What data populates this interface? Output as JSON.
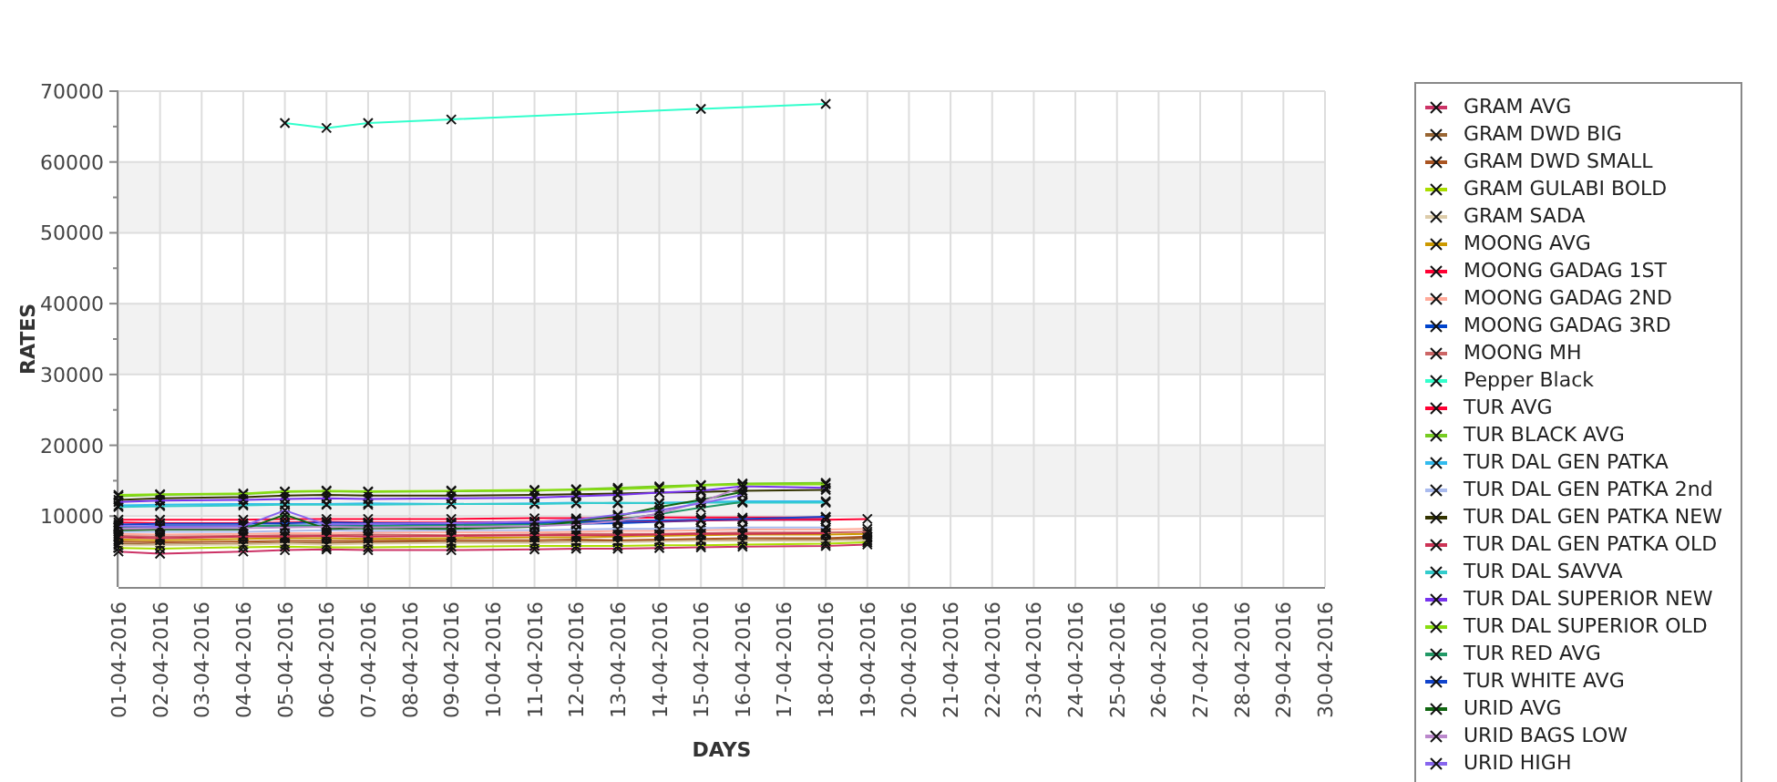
{
  "chart": {
    "chart_data": {
      "type": "line",
      "xlabel": "DAYS",
      "ylabel": "RATES",
      "ylim": [
        0,
        70000
      ],
      "grid": true,
      "yticks": [
        10000,
        20000,
        30000,
        40000,
        50000,
        60000,
        70000
      ],
      "categories": [
        "01-04-2016",
        "02-04-2016",
        "03-04-2016",
        "04-04-2016",
        "05-04-2016",
        "06-04-2016",
        "07-04-2016",
        "08-04-2016",
        "09-04-2016",
        "10-04-2016",
        "11-04-2016",
        "12-04-2016",
        "13-04-2016",
        "14-04-2016",
        "15-04-2016",
        "16-04-2016",
        "17-04-2016",
        "18-04-2016",
        "19-04-2016",
        "20-04-2016",
        "21-04-2016",
        "22-04-2016",
        "23-04-2016",
        "24-04-2016",
        "25-04-2016",
        "26-04-2016",
        "27-04-2016",
        "28-04-2016",
        "29-04-2016",
        "30-04-2016"
      ],
      "series": [
        {
          "name": "GRAM AVG",
          "color": "#cc3366",
          "marker": "x",
          "values": [
            5000,
            4700,
            null,
            5000,
            5200,
            5300,
            5200,
            null,
            5200,
            null,
            5300,
            5400,
            5400,
            5500,
            5600,
            5700,
            null,
            5800,
            6000,
            null,
            null,
            null,
            null,
            null,
            null,
            null,
            null,
            null,
            null,
            null
          ]
        },
        {
          "name": "GRAM DWD BIG",
          "color": "#996633",
          "marker": "x",
          "values": [
            6100,
            6000,
            null,
            6100,
            6200,
            6200,
            6300,
            null,
            6300,
            null,
            6300,
            6400,
            6500,
            6500,
            6600,
            6600,
            null,
            6700,
            6900,
            null,
            null,
            null,
            null,
            null,
            null,
            null,
            null,
            null,
            null,
            null
          ]
        },
        {
          "name": "GRAM DWD SMALL",
          "color": "#aa5522",
          "marker": "x",
          "values": [
            6400,
            6300,
            null,
            6400,
            6500,
            6500,
            6500,
            null,
            6600,
            null,
            6600,
            6700,
            6600,
            6700,
            6800,
            6900,
            null,
            6900,
            7100,
            null,
            null,
            null,
            null,
            null,
            null,
            null,
            null,
            null,
            null,
            null
          ]
        },
        {
          "name": "GRAM GULABI BOLD",
          "color": "#aadd00",
          "marker": "x",
          "values": [
            5500,
            5400,
            null,
            5600,
            5700,
            5600,
            5600,
            null,
            5700,
            null,
            5800,
            5800,
            5800,
            5900,
            5900,
            6000,
            null,
            6100,
            6300,
            null,
            null,
            null,
            null,
            null,
            null,
            null,
            null,
            null,
            null,
            null
          ]
        },
        {
          "name": "GRAM SADA",
          "color": "#ddccaa",
          "marker": "x",
          "values": [
            5900,
            5900,
            null,
            6000,
            6100,
            6000,
            6100,
            null,
            6200,
            null,
            6200,
            6300,
            6300,
            6400,
            6500,
            6500,
            null,
            6500,
            6600,
            null,
            null,
            null,
            null,
            null,
            null,
            null,
            null,
            null,
            null,
            null
          ]
        },
        {
          "name": "MOONG AVG",
          "color": "#cc9900",
          "marker": "x",
          "values": [
            6700,
            6600,
            null,
            6800,
            6900,
            6900,
            6800,
            null,
            6900,
            null,
            7000,
            7000,
            7100,
            7200,
            7300,
            7400,
            null,
            7400,
            7500,
            null,
            null,
            null,
            null,
            null,
            null,
            null,
            null,
            null,
            null,
            null
          ]
        },
        {
          "name": "MOONG GADAG 1ST",
          "color": "#ff0033",
          "marker": "x",
          "values": [
            9500,
            9500,
            null,
            9500,
            9600,
            9600,
            9600,
            null,
            9600,
            null,
            9700,
            9700,
            9700,
            9800,
            9800,
            9800,
            null,
            9800,
            null,
            null,
            null,
            null,
            null,
            null,
            null,
            null,
            null,
            null,
            null,
            null
          ]
        },
        {
          "name": "MOONG GADAG 2ND",
          "color": "#ffaa99",
          "marker": "x",
          "values": [
            7500,
            7400,
            null,
            7500,
            7600,
            7600,
            7700,
            null,
            7700,
            null,
            7700,
            7800,
            7900,
            7900,
            8000,
            8100,
            null,
            8100,
            8200,
            null,
            null,
            null,
            null,
            null,
            null,
            null,
            null,
            null,
            null,
            null
          ]
        },
        {
          "name": "MOONG GADAG 3RD",
          "color": "#0044cc",
          "marker": "x",
          "values": [
            8500,
            8600,
            null,
            8600,
            8700,
            8700,
            8700,
            null,
            8800,
            null,
            8900,
            8900,
            9000,
            9200,
            9400,
            9500,
            null,
            9500,
            null,
            null,
            null,
            null,
            null,
            null,
            null,
            null,
            null,
            null,
            null,
            null
          ]
        },
        {
          "name": "MOONG MH",
          "color": "#cc6666",
          "marker": "x",
          "values": [
            7200,
            7100,
            null,
            7200,
            7300,
            7300,
            7400,
            null,
            7300,
            null,
            7400,
            7500,
            7500,
            7500,
            7600,
            7700,
            null,
            7700,
            7800,
            null,
            null,
            null,
            null,
            null,
            null,
            null,
            null,
            null,
            null,
            null
          ]
        },
        {
          "name": "Pepper Black",
          "color": "#33ffcc",
          "marker": "x",
          "values": [
            null,
            null,
            null,
            null,
            65500,
            64800,
            65500,
            null,
            66000,
            null,
            null,
            null,
            null,
            null,
            67500,
            null,
            null,
            68200,
            null,
            null,
            null,
            null,
            null,
            null,
            null,
            null,
            null,
            null,
            null,
            null
          ]
        },
        {
          "name": "TUR AVG",
          "color": "#ff0033",
          "marker": "x",
          "values": [
            9100,
            9000,
            null,
            9000,
            9100,
            9200,
            9100,
            null,
            9100,
            null,
            9200,
            9300,
            9300,
            9300,
            9400,
            9500,
            null,
            9500,
            9600,
            null,
            null,
            null,
            null,
            null,
            null,
            null,
            null,
            null,
            null,
            null
          ]
        },
        {
          "name": "TUR BLACK AVG",
          "color": "#77cc22",
          "marker": "x",
          "values": [
            12800,
            13000,
            null,
            13100,
            13400,
            13500,
            13400,
            null,
            13500,
            null,
            13600,
            13800,
            14000,
            14200,
            14400,
            14600,
            null,
            14700,
            null,
            null,
            null,
            null,
            null,
            null,
            null,
            null,
            null,
            null,
            null,
            null
          ]
        },
        {
          "name": "TUR DAL GEN PATKA",
          "color": "#33bbee",
          "marker": "x",
          "values": [
            11500,
            11600,
            null,
            11700,
            11700,
            11700,
            11800,
            null,
            11700,
            null,
            11800,
            11900,
            11800,
            11900,
            12000,
            12100,
            null,
            12100,
            null,
            null,
            null,
            null,
            null,
            null,
            null,
            null,
            null,
            null,
            null,
            null
          ]
        },
        {
          "name": "TUR DAL GEN PATKA 2nd",
          "color": "#aabbee",
          "marker": "x",
          "values": [
            7800,
            7800,
            null,
            7800,
            7900,
            8000,
            7900,
            null,
            8000,
            null,
            8000,
            8100,
            8200,
            8200,
            8300,
            8400,
            null,
            8400,
            null,
            null,
            null,
            null,
            null,
            null,
            null,
            null,
            null,
            null,
            null,
            null
          ]
        },
        {
          "name": "TUR DAL GEN PATKA NEW",
          "color": "#333300",
          "marker": "x",
          "values": [
            12300,
            12500,
            null,
            12700,
            12900,
            13000,
            12900,
            null,
            12900,
            null,
            13000,
            13100,
            13200,
            13300,
            13400,
            13600,
            null,
            13700,
            null,
            null,
            null,
            null,
            null,
            null,
            null,
            null,
            null,
            null,
            null,
            null
          ]
        },
        {
          "name": "TUR DAL GEN PATKA OLD",
          "color": "#cc3355",
          "marker": "x",
          "values": [
            7000,
            6900,
            null,
            7100,
            7100,
            7200,
            7100,
            null,
            7200,
            null,
            7300,
            7300,
            7300,
            7400,
            7500,
            7500,
            null,
            7600,
            null,
            null,
            null,
            null,
            null,
            null,
            null,
            null,
            null,
            null,
            null,
            null
          ]
        },
        {
          "name": "TUR DAL SAVVA",
          "color": "#33cccc",
          "marker": "x",
          "values": [
            11300,
            11400,
            null,
            11500,
            11600,
            11600,
            11600,
            null,
            11700,
            null,
            11700,
            11800,
            11900,
            11800,
            11900,
            11900,
            null,
            11900,
            null,
            null,
            null,
            null,
            null,
            null,
            null,
            null,
            null,
            null,
            null,
            null
          ]
        },
        {
          "name": "TUR DAL SUPERIOR NEW",
          "color": "#7733ee",
          "marker": "x",
          "values": [
            12000,
            12200,
            null,
            12300,
            12400,
            12500,
            12400,
            null,
            12500,
            null,
            12600,
            12800,
            13000,
            13300,
            13600,
            14200,
            null,
            14000,
            null,
            null,
            null,
            null,
            null,
            null,
            null,
            null,
            null,
            null,
            null,
            null
          ]
        },
        {
          "name": "TUR DAL SUPERIOR OLD",
          "color": "#88dd11",
          "marker": "x",
          "values": [
            13000,
            13100,
            null,
            13200,
            13500,
            13600,
            13500,
            null,
            13600,
            null,
            13700,
            13700,
            13800,
            14000,
            14300,
            14500,
            null,
            14500,
            null,
            null,
            null,
            null,
            null,
            null,
            null,
            null,
            null,
            null,
            null,
            null
          ]
        },
        {
          "name": "TUR RED AVG",
          "color": "#229966",
          "marker": "x",
          "values": [
            8400,
            8500,
            null,
            8600,
            8700,
            8600,
            8600,
            null,
            8700,
            null,
            8800,
            9000,
            9500,
            10300,
            11200,
            12000,
            null,
            null,
            null,
            null,
            null,
            null,
            null,
            null,
            null,
            null,
            null,
            null,
            null,
            null
          ]
        },
        {
          "name": "TUR WHITE AVG",
          "color": "#1144cc",
          "marker": "x",
          "values": [
            8800,
            8900,
            null,
            8900,
            9000,
            9100,
            9000,
            null,
            9000,
            null,
            9100,
            9200,
            9300,
            9400,
            9500,
            9600,
            null,
            9900,
            null,
            null,
            null,
            null,
            null,
            null,
            null,
            null,
            null,
            null,
            null,
            null
          ]
        },
        {
          "name": "URID AVG",
          "color": "#116611",
          "marker": "x",
          "values": [
            8000,
            8100,
            null,
            8100,
            10200,
            8200,
            8300,
            null,
            8200,
            null,
            8500,
            9300,
            10000,
            11300,
            12300,
            13400,
            null,
            null,
            null,
            null,
            null,
            null,
            null,
            null,
            null,
            null,
            null,
            null,
            null,
            null
          ]
        },
        {
          "name": "URID BAGS LOW",
          "color": "#bb88cc",
          "marker": "x",
          "values": [
            8200,
            8300,
            null,
            8300,
            8400,
            8500,
            8400,
            null,
            8500,
            null,
            8600,
            8800,
            9300,
            10400,
            12000,
            14100,
            null,
            null,
            null,
            null,
            null,
            null,
            null,
            null,
            null,
            null,
            null,
            null,
            null,
            null
          ]
        },
        {
          "name": "URID HIGH",
          "color": "#8866ee",
          "marker": "x",
          "values": [
            8600,
            8500,
            null,
            8600,
            10800,
            8800,
            8900,
            null,
            9000,
            null,
            9200,
            9500,
            10200,
            10800,
            11800,
            13000,
            null,
            null,
            null,
            null,
            null,
            null,
            null,
            null,
            null,
            null,
            null,
            null,
            null,
            null
          ]
        }
      ]
    }
  }
}
